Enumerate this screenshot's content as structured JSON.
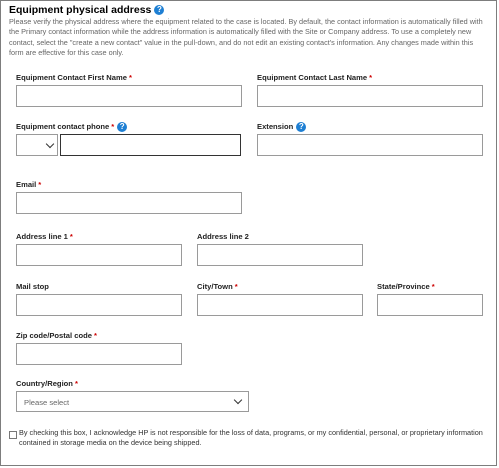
{
  "section": {
    "title": "Equipment physical address",
    "intro": "Please verify the physical address where the equipment related to the case is located. By default, the contact information is automatically filled with the Primary contact information while the address information is automatically filled with the Site or Company address. To use a completely new contact, select the \"create a new contact\" value in the pull-down, and do not edit an existing contact's information. Any changes made within this form are effective for this case only."
  },
  "fields": {
    "first_name": {
      "label": "Equipment Contact First Name",
      "value": ""
    },
    "last_name": {
      "label": "Equipment Contact Last Name",
      "value": ""
    },
    "phone": {
      "label": "Equipment contact phone",
      "country_code": "",
      "value": ""
    },
    "extension": {
      "label": "Extension",
      "value": ""
    },
    "email": {
      "label": "Email",
      "value": ""
    },
    "address1": {
      "label": "Address line 1",
      "value": ""
    },
    "address2": {
      "label": "Address line 2",
      "value": ""
    },
    "mail_stop": {
      "label": "Mail stop",
      "value": ""
    },
    "city": {
      "label": "City/Town",
      "value": ""
    },
    "state": {
      "label": "State/Province",
      "value": ""
    },
    "zip": {
      "label": "Zip code/Postal code",
      "value": ""
    },
    "country": {
      "label": "Country/Region",
      "selected": "Please select"
    }
  },
  "required_marker": "*",
  "help_glyph": "?",
  "disclaimer": {
    "checked": false,
    "text": "By checking this box, I acknowledge HP is not responsible for the loss of data, programs, or my confidential, personal, or proprietary information contained in storage media on the device being shipped."
  },
  "colors": {
    "help_icon": "#1e7fd3",
    "required": "#cc0000",
    "border": "#9a9a9a"
  }
}
